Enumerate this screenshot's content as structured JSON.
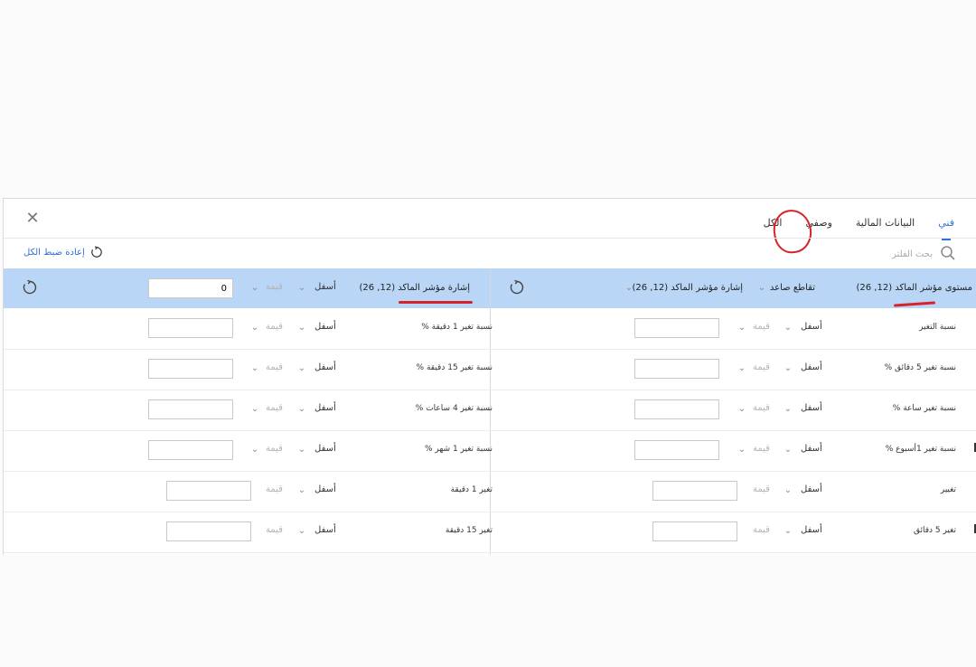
{
  "tabs": [
    {
      "label": "الكل",
      "active": false
    },
    {
      "label": "وصفي",
      "active": false
    },
    {
      "label": "البيانات المالية",
      "active": false
    },
    {
      "label": "فني",
      "active": true
    }
  ],
  "search": {
    "placeholder": "بحث الفلتر"
  },
  "reset_all": {
    "label": "إعادة ضبط الكل"
  },
  "header": {
    "right": {
      "level_label": "مستوى مؤشر الماكد (12, 26)",
      "cross_label": "تقاطع صاعد",
      "signal_label": "إشارة مؤشر الماكد (12, 26)"
    },
    "left": {
      "signal_label": "إشارة مؤشر الماكد (12, 26)",
      "direction": "أسفل",
      "value_placeholder": "قيمة",
      "value": "0"
    }
  },
  "rows": [
    {
      "right": {
        "label": "نسبة التغير",
        "direction": "أسفل",
        "value_placeholder": "قيمة"
      },
      "left": {
        "label": "نسبة تغير 1 دقيقة %",
        "direction": "أسفل",
        "value_placeholder": "قيمة"
      }
    },
    {
      "right": {
        "label": "نسبة تغير 5 دقائق %",
        "direction": "أسفل",
        "value_placeholder": "قيمة"
      },
      "left": {
        "label": "نسبة تغير 15 دقيقة %",
        "direction": "أسفل",
        "value_placeholder": "قيمة"
      }
    },
    {
      "right": {
        "label": "نسبة تغير ساعة %",
        "direction": "أسفل",
        "value_placeholder": "قيمة"
      },
      "left": {
        "label": "نسبة تغير 4 ساعات %",
        "direction": "أسفل",
        "value_placeholder": "قيمة"
      }
    },
    {
      "right": {
        "label": "نسبة تغير 1أسبوع %",
        "direction": "أسفل",
        "value_placeholder": "قيمة"
      },
      "left": {
        "label": "نسبة تغير 1 شهر %",
        "direction": "أسفل",
        "value_placeholder": "قيمة"
      }
    },
    {
      "right": {
        "label": "تغيير",
        "direction": "أسفل",
        "value_placeholder": "قيمة"
      },
      "left": {
        "label": "تغير 1 دقيقة",
        "direction": "أسفل",
        "value_placeholder": "قيمة"
      }
    },
    {
      "right": {
        "label": "تغير 5 دقائق",
        "direction": "أسفل",
        "value_placeholder": "قيمة"
      },
      "left": {
        "label": "تغير 15 دقيقة",
        "direction": "أسفل",
        "value_placeholder": "قيمة"
      }
    }
  ],
  "colors": {
    "accent": "#2f6fd6",
    "header_bg": "#b9d6f6",
    "annotation": "#d6222a"
  }
}
